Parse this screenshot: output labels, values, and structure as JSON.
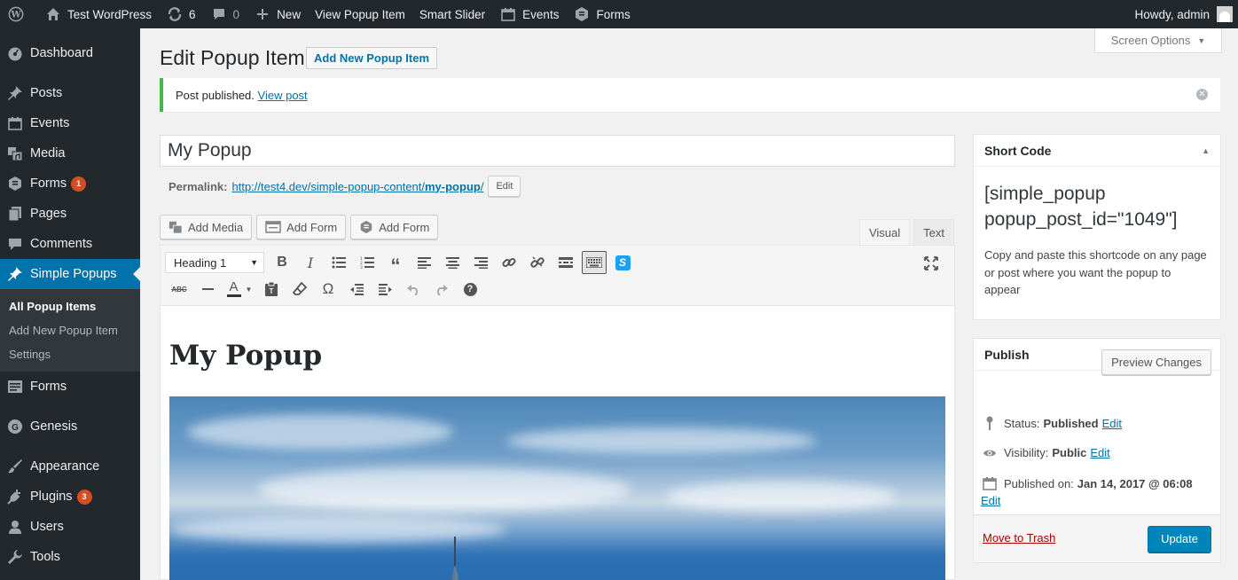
{
  "adminbar": {
    "site_name": "Test WordPress",
    "updates_count": "6",
    "comments_count": "0",
    "new_label": "New",
    "view_item": "View Popup Item",
    "smart_slider": "Smart Slider",
    "events": "Events",
    "forms": "Forms",
    "howdy": "Howdy, admin"
  },
  "sidebar": {
    "dashboard": "Dashboard",
    "posts": "Posts",
    "events": "Events",
    "media": "Media",
    "forms": "Forms",
    "forms_badge": "1",
    "pages": "Pages",
    "comments": "Comments",
    "simple_popups": "Simple Popups",
    "submenu": [
      "All Popup Items",
      "Add New Popup Item",
      "Settings"
    ],
    "forms2": "Forms",
    "genesis": "Genesis",
    "appearance": "Appearance",
    "plugins": "Plugins",
    "plugins_badge": "3",
    "users": "Users",
    "tools": "Tools"
  },
  "header": {
    "title": "Edit Popup Item",
    "add_new": "Add New Popup Item",
    "screen_options": "Screen Options"
  },
  "notice": {
    "text": "Post published.",
    "link": "View post"
  },
  "post": {
    "title_value": "My Popup",
    "permalink_label": "Permalink:",
    "permalink_base": "http://test4.dev/simple-popup-content/",
    "permalink_slug": "my-popup",
    "permalink_tail": "/",
    "edit_label": "Edit"
  },
  "media_buttons": [
    "Add Media",
    "Add Form",
    "Add Form"
  ],
  "editor_tabs": {
    "visual": "Visual",
    "text": "Text"
  },
  "toolbar": {
    "format": "Heading 1"
  },
  "content": {
    "heading": "My Popup"
  },
  "shortcode_box": {
    "title": "Short Code",
    "code_line1": "[simple_popup",
    "code_line2": "popup_post_id=\"1049\"]",
    "help": "Copy and paste this shortcode on any page or post where you want the popup to appear"
  },
  "publish_box": {
    "title": "Publish",
    "preview": "Preview Changes",
    "status_label": "Status:",
    "status_value": "Published",
    "visibility_label": "Visibility:",
    "visibility_value": "Public",
    "published_label": "Published on:",
    "published_value": "Jan 14, 2017 @ 06:08",
    "edit": "Edit",
    "trash": "Move to Trash",
    "update": "Update"
  },
  "colors": {
    "accent": "#0073aa",
    "adminbar": "#23282d",
    "notice_border": "#46b450",
    "update_button": "#0085ba"
  }
}
